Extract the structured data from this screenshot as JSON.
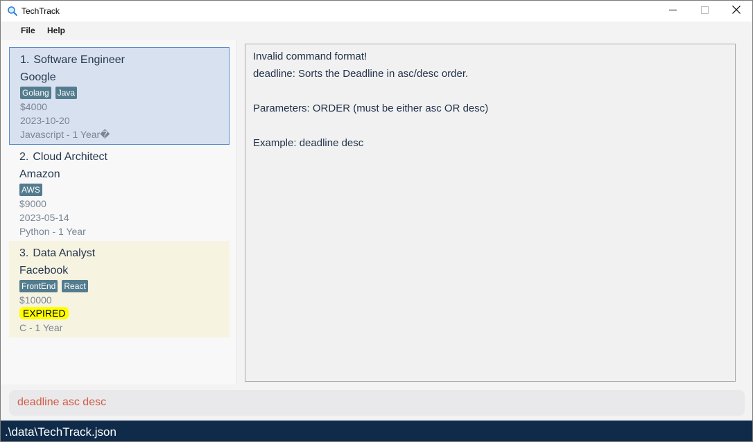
{
  "window": {
    "title": "TechTrack",
    "app_icon": "magnifier-icon"
  },
  "window_controls": [
    "minimize-icon",
    "maximize-icon",
    "close-icon"
  ],
  "menu": {
    "file_label": "File",
    "help_label": "Help"
  },
  "jobs": [
    {
      "index": "1.",
      "role": "Software Engineer",
      "company": "Google",
      "tags": [
        "Golang",
        "Java"
      ],
      "salary": "$4000",
      "deadline": "2023-10-20",
      "experience": "Javascript - 1 Year�"
    },
    {
      "index": "2.",
      "role": "Cloud Architect",
      "company": "Amazon",
      "tags": [
        "AWS"
      ],
      "salary": "$9000",
      "deadline": "2023-05-14",
      "experience": "Python - 1 Year"
    },
    {
      "index": "3.",
      "role": "Data Analyst",
      "company": "Facebook",
      "tags": [
        "FrontEnd",
        "React"
      ],
      "salary": "$10000",
      "status": "EXPIRED",
      "experience": "C - 1 Year"
    }
  ],
  "result": {
    "lines": [
      "Invalid command format!",
      "deadline: Sorts the Deadline in asc/desc order.",
      "Parameters: ORDER (must be either asc OR desc)",
      "Example: deadline desc"
    ]
  },
  "command": {
    "value": "deadline asc desc"
  },
  "status_bar": {
    "path": ".\\data\\TechTrack.json"
  },
  "colors": {
    "selected_card_bg": "#d8e1ef",
    "selected_card_border": "#5b8cc9",
    "expired_card_bg": "#f6f3e1",
    "tag_bg": "#537c8e",
    "expired_badge_bg": "#ffff00",
    "command_text": "#d25b45",
    "status_bar_bg": "#0f2b49"
  }
}
